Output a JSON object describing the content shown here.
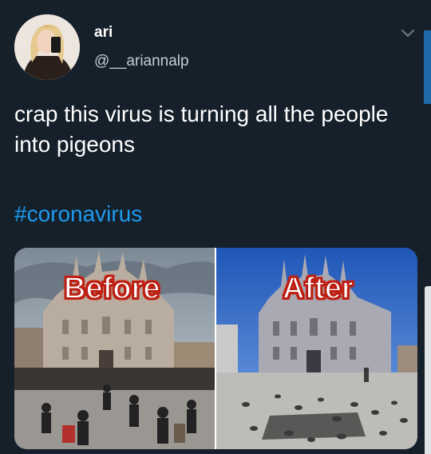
{
  "tweet": {
    "display_name": "ari",
    "handle": "@__ariannalp",
    "text": "crap this virus is turning all the people into pigeons",
    "hashtag": "#coronavirus"
  },
  "media": {
    "before_label": "Before",
    "after_label": "After"
  },
  "icons": {
    "menu": "chevron-down-icon"
  },
  "colors": {
    "background": "#15202b",
    "hashtag": "#1d9bf0",
    "label_outline": "#c62414"
  }
}
